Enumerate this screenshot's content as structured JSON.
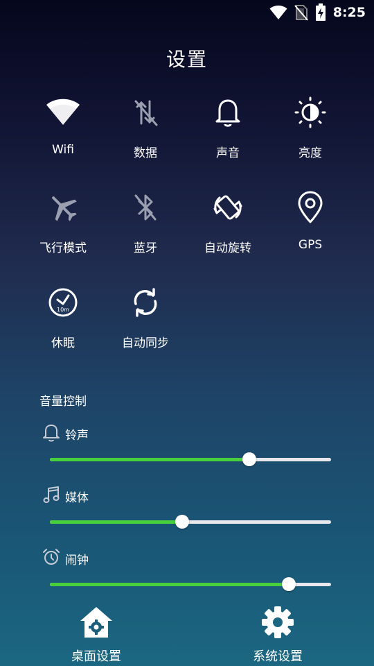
{
  "status_bar": {
    "time": "8:25",
    "icons": [
      "wifi-icon",
      "no-sim-icon",
      "battery-charging-icon"
    ]
  },
  "title": "设置",
  "tiles": [
    {
      "label": "Wifi",
      "icon": "wifi-icon",
      "state": "on"
    },
    {
      "label": "数据",
      "icon": "mobile-data-off-icon",
      "state": "off"
    },
    {
      "label": "声音",
      "icon": "bell-icon",
      "state": "on"
    },
    {
      "label": "亮度",
      "icon": "brightness-icon",
      "state": "on"
    },
    {
      "label": "飞行模式",
      "icon": "airplane-icon",
      "state": "off"
    },
    {
      "label": "蓝牙",
      "icon": "bluetooth-off-icon",
      "state": "off"
    },
    {
      "label": "自动旋转",
      "icon": "auto-rotate-icon",
      "state": "on"
    },
    {
      "label": "GPS",
      "icon": "location-pin-icon",
      "state": "on"
    },
    {
      "label": "休眠",
      "icon": "sleep-timer-icon",
      "state": "on"
    },
    {
      "label": "自动同步",
      "icon": "sync-icon",
      "state": "on"
    }
  ],
  "volume": {
    "section_title": "音量控制",
    "items": [
      {
        "label": "铃声",
        "icon": "bell-outline-icon",
        "level": 0.71
      },
      {
        "label": "媒体",
        "icon": "music-note-icon",
        "level": 0.47
      },
      {
        "label": "闹钟",
        "icon": "alarm-clock-icon",
        "level": 0.85
      }
    ]
  },
  "bottom": {
    "desktop_settings": "桌面设置",
    "system_settings": "系统设置"
  },
  "colors": {
    "slider_fill": "#48cf3c",
    "slider_track": "#e8e8ec",
    "disabled_icon": "#9aa0b0"
  }
}
